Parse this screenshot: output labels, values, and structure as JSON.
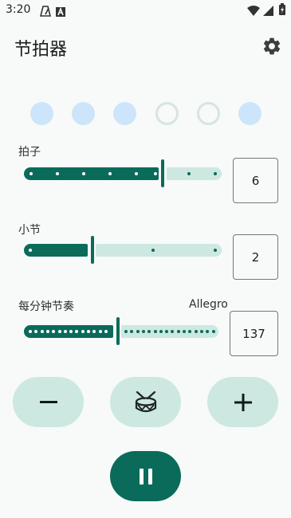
{
  "status_bar": {
    "time": "3:20",
    "icons": [
      "metronome-notification-icon",
      "accessibility-icon",
      "wifi-icon",
      "cell-signal-icon",
      "battery-charging-icon"
    ]
  },
  "app_bar": {
    "title": "节拍器",
    "settings_icon": "gear-icon"
  },
  "beat_indicator": {
    "states": [
      "filled",
      "filled",
      "filled",
      "empty",
      "empty",
      "filled"
    ],
    "filled_color": "#cde5fb",
    "empty_border_color": "#d6e5df"
  },
  "beats": {
    "label": "拍子",
    "value": "6"
  },
  "bars": {
    "label": "小节",
    "value": "2"
  },
  "tempo": {
    "label": "每分钟节奏",
    "marking": "Allegro",
    "value": "137"
  },
  "controls": {
    "decrease_icon": "minus-icon",
    "drum_icon": "drum-icon",
    "increase_icon": "plus-icon",
    "play_pause_icon": "pause-icon"
  },
  "colors": {
    "primary": "#0b6b5b",
    "primary_container": "#cde8e1",
    "background": "#f7faf8"
  }
}
